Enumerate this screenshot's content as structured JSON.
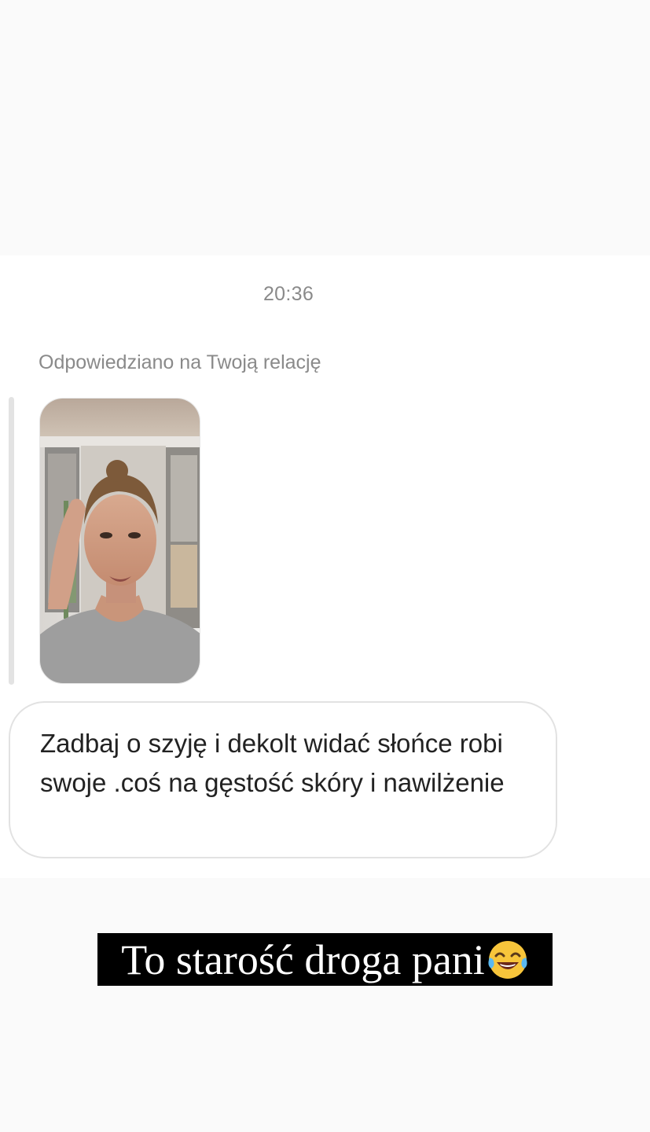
{
  "chat": {
    "timestamp": "20:36",
    "reply_context": "Odpowiedziano na Twoją relację",
    "story_thumbnail": {
      "icon": "story-photo",
      "alt": ""
    },
    "message": "Zadbaj o szyję i dekolt widać słońce robi swoje .coś na gęstość skóry i nawilżenie"
  },
  "caption": {
    "text": "To starość droga pani",
    "emoji": "face-with-tears-of-joy-icon",
    "background": "#000000",
    "color": "#ffffff"
  },
  "colors": {
    "page_bg": "#fafafa",
    "chat_bg": "#ffffff",
    "muted_text": "#8a8a8a",
    "bubble_border": "#e2e2e2"
  }
}
